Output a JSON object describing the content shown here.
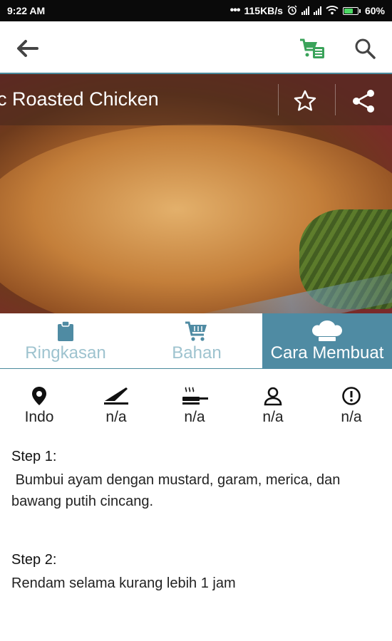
{
  "status_bar": {
    "time": "9:22 AM",
    "network_speed": "115KB/s",
    "battery_percent": "60%",
    "battery_level": 0.6,
    "icons": [
      "dots-icon",
      "alarm-icon",
      "signal-icon",
      "signal-icon",
      "wifi-icon",
      "battery-icon"
    ]
  },
  "app_bar": {
    "icons": [
      "back-arrow-icon",
      "shopping-cart-list-icon",
      "search-icon"
    ],
    "cart_color": "#3aa35a"
  },
  "recipe": {
    "title": "c Roasted Chicken",
    "actions": [
      "star-icon",
      "share-icon"
    ]
  },
  "tabs": [
    {
      "label": "Ringkasan",
      "icon": "clipboard-icon",
      "active": false
    },
    {
      "label": "Bahan",
      "icon": "cart-icon",
      "active": false
    },
    {
      "label": "Cara Membuat",
      "icon": "chef-hat-icon",
      "active": true
    }
  ],
  "info": [
    {
      "icon": "location-pin-icon",
      "value": "Indo"
    },
    {
      "icon": "knife-icon",
      "value": "n/a"
    },
    {
      "icon": "pan-icon",
      "value": "n/a"
    },
    {
      "icon": "person-icon",
      "value": "n/a"
    },
    {
      "icon": "alert-icon",
      "value": "n/a"
    }
  ],
  "steps": [
    {
      "title": "Step 1:",
      "text": " Bumbui ayam dengan mustard, garam, merica, dan bawang putih cincang."
    },
    {
      "title": "Step 2:",
      "text": "Rendam selama kurang lebih 1 jam"
    }
  ],
  "colors": {
    "accent": "#4f8ba3",
    "tab_inactive_text": "#9ec3cf",
    "status_bar": "#0a0a0a"
  }
}
